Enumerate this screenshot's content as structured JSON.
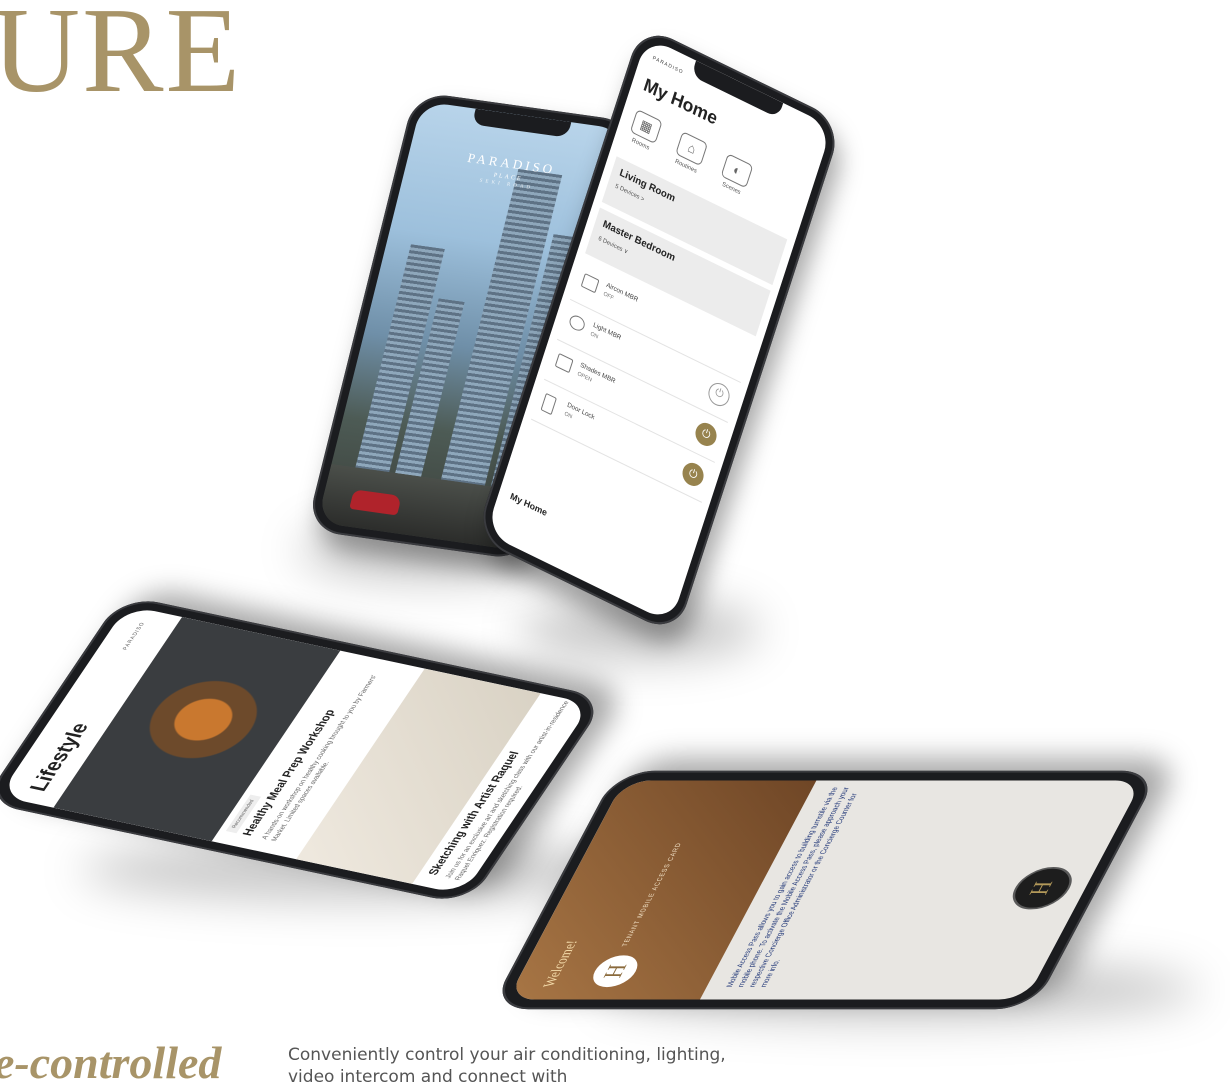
{
  "headline": "URE",
  "subline": "e-controlled",
  "body_copy": "Conveniently control your air conditioning, lighting, video intercom and connect with",
  "colors": {
    "gold": "#a89468",
    "dark_gold": "#97834e"
  },
  "phone_a": {
    "brand": "PARADISO",
    "sub": "PLACE",
    "tag": "SEKI ROAD"
  },
  "phone_b": {
    "brand": "PARADISO",
    "title": "My Home",
    "tabs": [
      {
        "label": "Rooms",
        "icon": "grid-icon"
      },
      {
        "label": "Routines",
        "icon": "home-icon"
      },
      {
        "label": "Scenes",
        "icon": "scene-icon"
      }
    ],
    "rooms": [
      {
        "name": "Living Room",
        "devices": "5 Devices >"
      },
      {
        "name": "Master Bedroom",
        "devices": "6 Devices ∨"
      }
    ],
    "devices": [
      {
        "name": "Aircon MBR",
        "status": "OFF",
        "icon": "aircon-icon",
        "power_on": false
      },
      {
        "name": "Light MBR",
        "status": "ON",
        "icon": "bulb-icon",
        "power_on": false
      },
      {
        "name": "Shades MBR",
        "status": "OPEN",
        "icon": "shades-icon",
        "power_on": true
      },
      {
        "name": "Door Lock",
        "status": "ON",
        "icon": "lock-icon",
        "power_on": true
      }
    ],
    "footer": "My Home"
  },
  "phone_c": {
    "title": "Lifestyle",
    "brand": "PARADISO",
    "tag": "Recommended",
    "cards": [
      {
        "title": "Healthy Meal Prep Workshop",
        "desc": "A hands-on workshop on healthy cooking brought to you by Farmers' Market. Limited spaces available."
      },
      {
        "title": "Sketching with Artist Raquel",
        "desc": "Join us for an exclusive art and sketching class with our artist-in-residence Raquel Enriquez. Registration required."
      }
    ]
  },
  "phone_d": {
    "welcome": "Welcome!",
    "logo_letter": "H",
    "pass": "TENANT MOBILE ACCESS CARD",
    "text": "Mobile Access Pass allows you to gain access to building turnstile via the mobile phone. To activate the Mobile Access Pass, please approach your respective Concierge Office Administrator or the Concierge Counter for more info.",
    "badge": "H"
  }
}
